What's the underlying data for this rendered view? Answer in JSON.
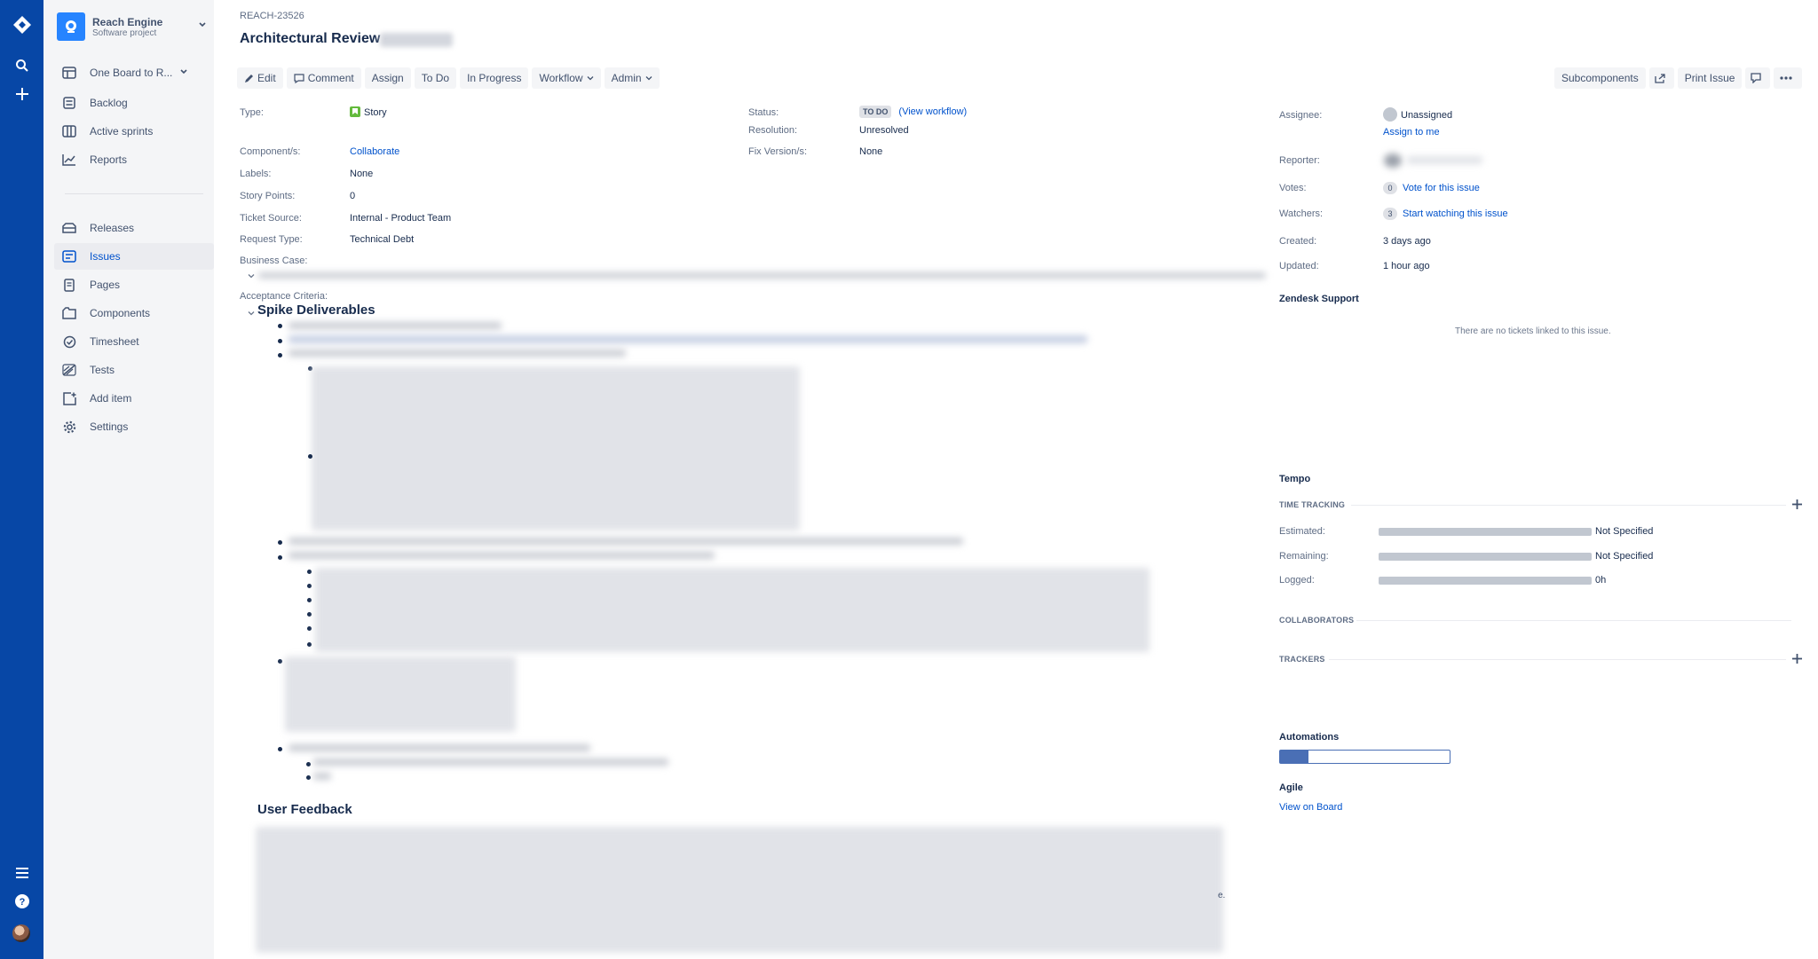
{
  "project": {
    "name": "Reach Engine",
    "type": "Software project",
    "board": "One Board to R..."
  },
  "sidebar": {
    "items": [
      {
        "label": "Backlog",
        "icon": "backlog-icon"
      },
      {
        "label": "Active sprints",
        "icon": "active-sprints-icon"
      },
      {
        "label": "Reports",
        "icon": "reports-icon"
      },
      {
        "label": "Releases",
        "icon": "releases-icon"
      },
      {
        "label": "Issues",
        "icon": "issues-icon"
      },
      {
        "label": "Pages",
        "icon": "pages-icon"
      },
      {
        "label": "Components",
        "icon": "components-icon"
      },
      {
        "label": "Timesheet",
        "icon": "timesheet-icon"
      },
      {
        "label": "Tests",
        "icon": "tests-icon"
      },
      {
        "label": "Add item",
        "icon": "add-item-icon"
      },
      {
        "label": "Settings",
        "icon": "settings-icon"
      }
    ]
  },
  "issue": {
    "key": "REACH-23526",
    "title": "Architectural Review -"
  },
  "toolbar": {
    "edit": "Edit",
    "comment": "Comment",
    "assign": "Assign",
    "todo": "To Do",
    "in_progress": "In Progress",
    "workflow": "Workflow",
    "admin": "Admin",
    "subcomponents": "Subcomponents",
    "print_issue": "Print Issue"
  },
  "details": {
    "type_label": "Type:",
    "type_value": "Story",
    "components_label": "Component/s:",
    "components_value": "Collaborate",
    "labels_label": "Labels:",
    "labels_value": "None",
    "story_points_label": "Story Points:",
    "story_points_value": "0",
    "ticket_source_label": "Ticket Source:",
    "ticket_source_value": "Internal - Product Team",
    "request_type_label": "Request Type:",
    "request_type_value": "Technical Debt",
    "business_case_label": "Business Case:",
    "acceptance_label": "Acceptance Criteria:",
    "status_label": "Status:",
    "status_value": "TO DO",
    "view_workflow": "(View workflow)",
    "resolution_label": "Resolution:",
    "resolution_value": "Unresolved",
    "fix_version_label": "Fix Version/s:",
    "fix_version_value": "None"
  },
  "description": {
    "spike_heading": "Spike Deliverables",
    "feedback_heading": "User Feedback",
    "trailing_char": "e."
  },
  "people": {
    "assignee_label": "Assignee:",
    "assignee_value": "Unassigned",
    "assign_to_me": "Assign to me",
    "reporter_label": "Reporter:",
    "votes_label": "Votes:",
    "votes_count": "0",
    "vote_link": "Vote for this issue",
    "watchers_label": "Watchers:",
    "watchers_count": "3",
    "watch_link": "Start watching this issue",
    "created_label": "Created:",
    "created_value": "3 days ago",
    "updated_label": "Updated:",
    "updated_value": "1 hour ago"
  },
  "zendesk": {
    "title": "Zendesk Support",
    "empty": "There are no tickets linked to this issue."
  },
  "tempo": {
    "title": "Tempo",
    "time_tracking": "TIME TRACKING",
    "estimated_label": "Estimated:",
    "estimated_value": "Not Specified",
    "remaining_label": "Remaining:",
    "remaining_value": "Not Specified",
    "logged_label": "Logged:",
    "logged_value": "0h",
    "collaborators": "COLLABORATORS",
    "trackers": "TRACKERS"
  },
  "automations": {
    "title": "Automations",
    "progress_fraction": 0.17
  },
  "agile": {
    "title": "Agile",
    "view_on_board": "View on Board"
  },
  "colors": {
    "nav_bg": "#0747a6",
    "sidebar_bg": "#f4f5f7",
    "link": "#0052cc",
    "story_green": "#63ba3c"
  }
}
